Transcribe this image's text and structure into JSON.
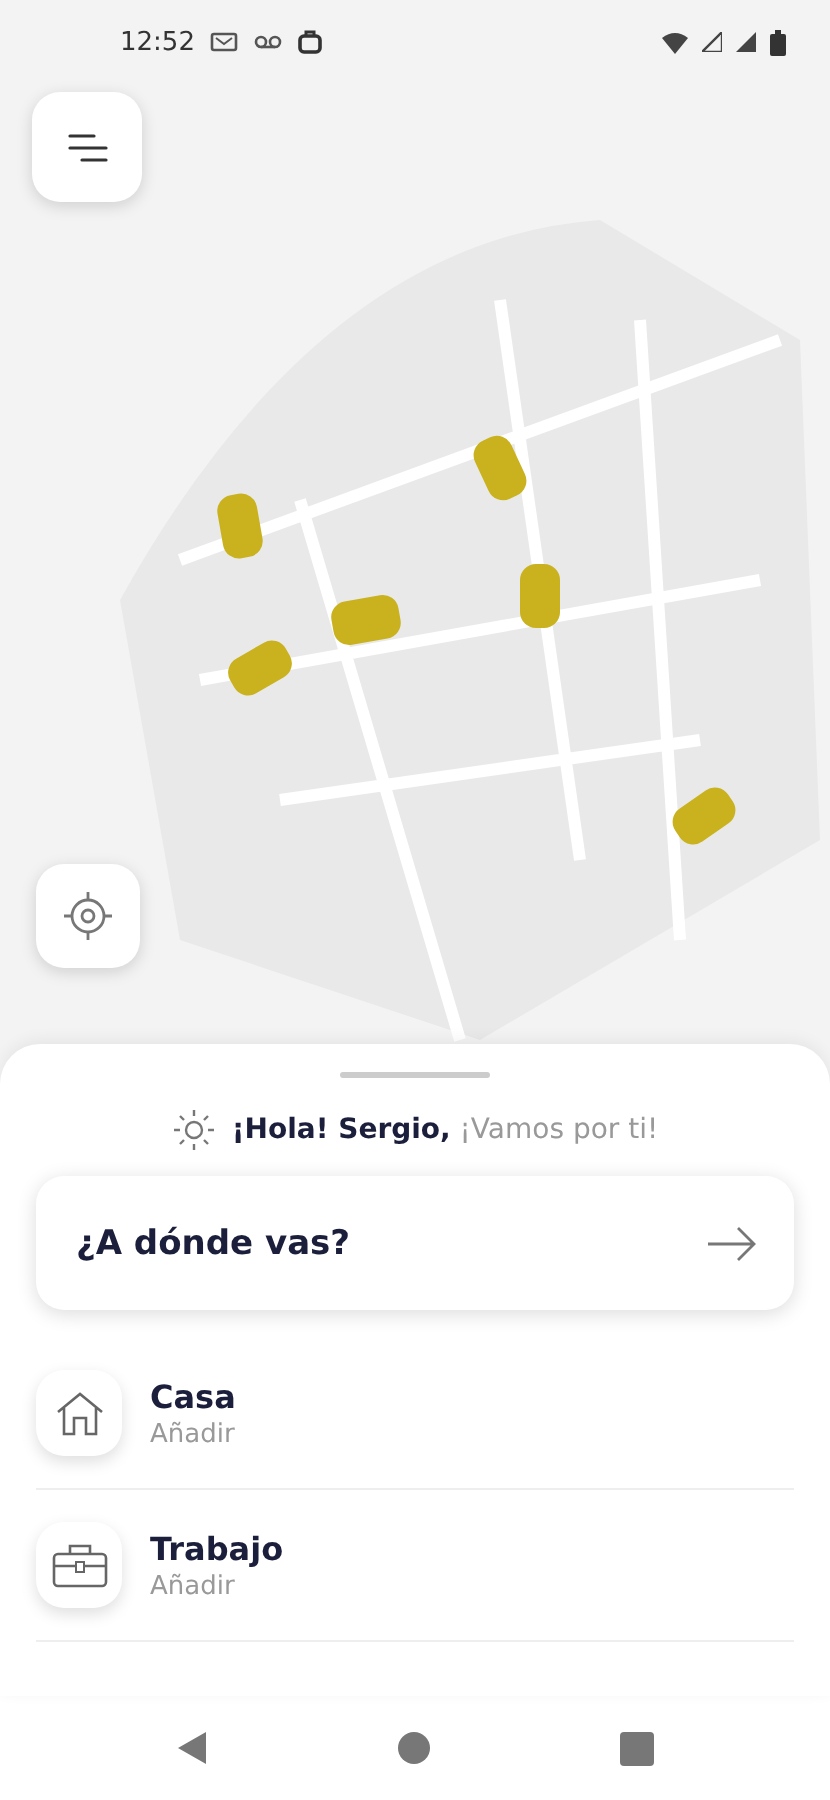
{
  "status_bar": {
    "time": "12:52"
  },
  "sheet": {
    "greeting": "**¡Hola! Sergio,** ¡Vamos por ti!",
    "destination": {
      "placeholder": "¿A dónde vas?"
    },
    "places": [
      {
        "kind": "home",
        "title": "Casa",
        "subtitle": "Añadir"
      },
      {
        "kind": "work",
        "title": "Trabajo",
        "subtitle": "Añadir"
      }
    ]
  },
  "nav_bar": [
    {
      "kind": "back"
    },
    {
      "kind": "home"
    },
    {
      "kind": "recents"
    }
  ]
}
